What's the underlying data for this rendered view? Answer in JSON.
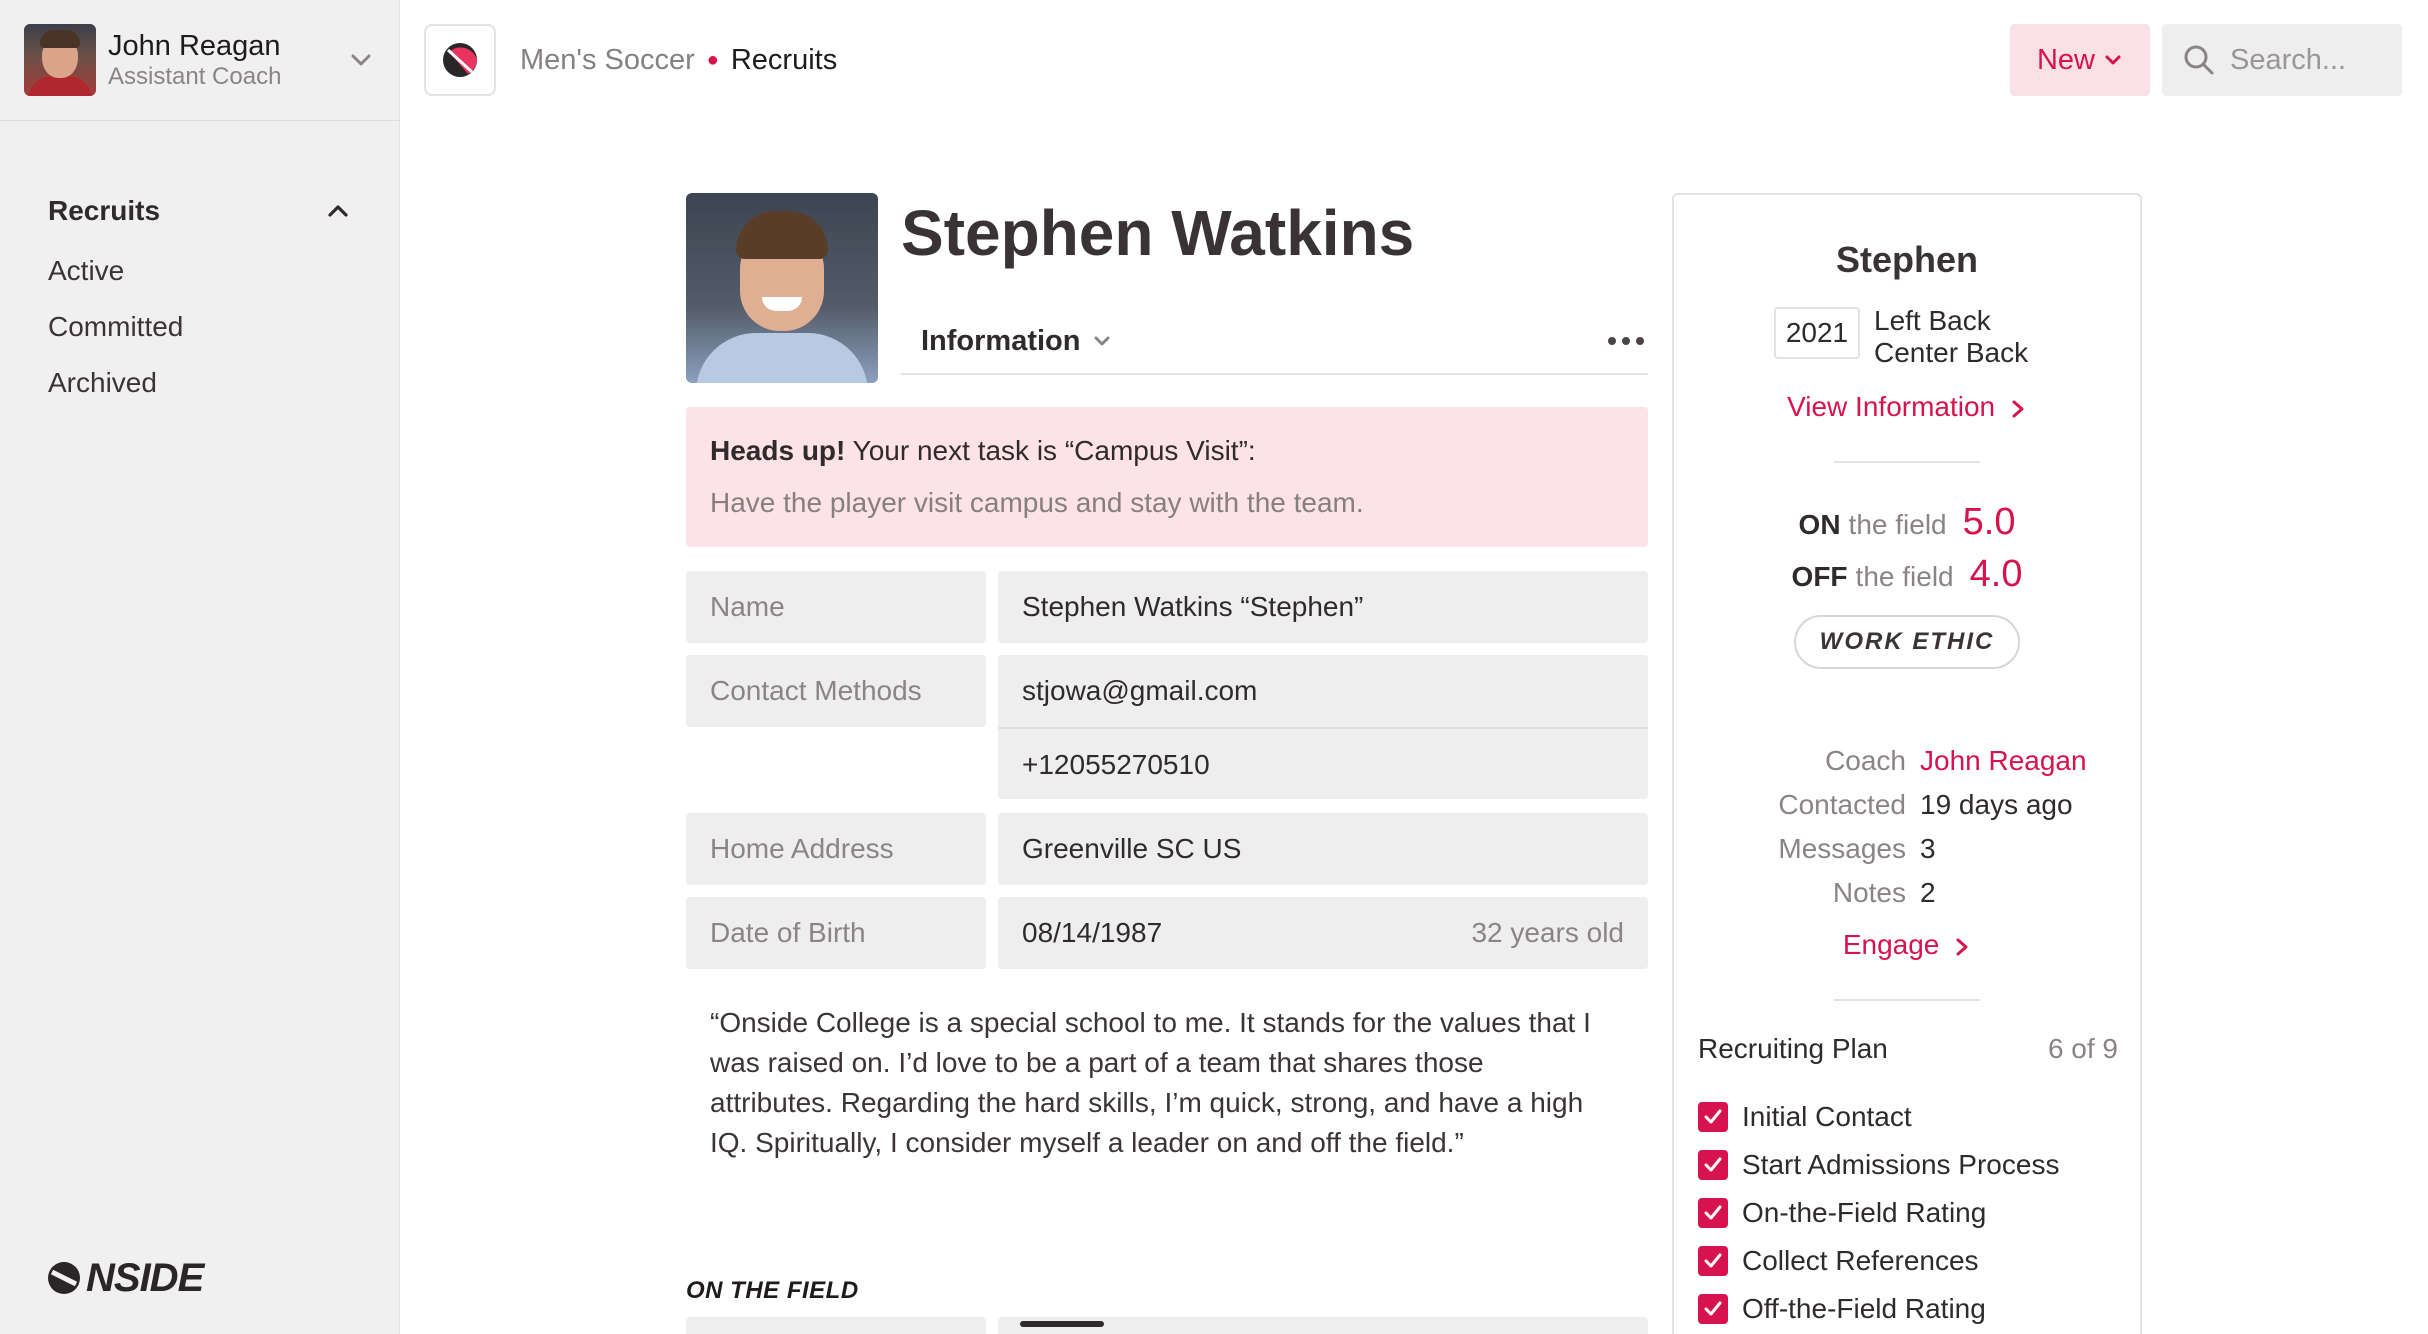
{
  "user": {
    "name": "John Reagan",
    "role": "Assistant Coach"
  },
  "sidebar": {
    "section_title": "Recruits",
    "items": [
      {
        "label": "Active"
      },
      {
        "label": "Committed"
      },
      {
        "label": "Archived"
      }
    ],
    "logo_text": "NSIDE"
  },
  "header": {
    "breadcrumb_parent": "Men's Soccer",
    "breadcrumb_current": "Recruits",
    "new_label": "New",
    "search_placeholder": "Search..."
  },
  "profile": {
    "name": "Stephen Watkins",
    "tab_label": "Information",
    "alert_title": "Heads up!",
    "alert_text": " Your next task is “Campus Visit”:",
    "alert_detail": "Have the player visit campus and stay with the team.",
    "fields": {
      "name_label": "Name",
      "name_value": "Stephen Watkins “Stephen”",
      "contact_label": "Contact Methods",
      "email": "stjowa@gmail.com",
      "phone": "+12055270510",
      "address_label": "Home Address",
      "address_value": "Greenville SC US",
      "dob_label": "Date of Birth",
      "dob_value": "08/14/1987",
      "age": "32 years old"
    },
    "quote": "“Onside College is a special school to me. It stands for the values that I was raised on. I’d love to be a part of a team that shares those attributes. Regarding the hard skills, I’m quick, strong, and have a high IQ. Spiritually, I consider myself a leader on and off the field.”",
    "section_on_field": "ON THE FIELD"
  },
  "card": {
    "first_name": "Stephen",
    "year": "2021",
    "position_1": "Left Back",
    "position_2": "Center Back",
    "view_info": "View Information",
    "on_label": "ON",
    "on_suffix": "the field",
    "on_rating": "5.0",
    "off_label": "OFF",
    "off_suffix": "the field",
    "off_rating": "4.0",
    "tag": "WORK ETHIC",
    "stats": [
      {
        "key": "Coach",
        "value": "John Reagan"
      },
      {
        "key": "Contacted",
        "value": "19 days ago"
      },
      {
        "key": "Messages",
        "value": "3"
      },
      {
        "key": "Notes",
        "value": "2"
      }
    ],
    "engage": "Engage",
    "plan_title": "Recruiting Plan",
    "plan_count": "6 of 9",
    "plan_items": [
      {
        "label": "Initial Contact",
        "checked": true
      },
      {
        "label": "Start Admissions Process",
        "checked": true
      },
      {
        "label": "On-the-Field Rating",
        "checked": true
      },
      {
        "label": "Collect References",
        "checked": true
      },
      {
        "label": "Off-the-Field Rating",
        "checked": true
      }
    ]
  },
  "colors": {
    "accent": "#d6134e",
    "accent_soft": "#fbe0e7",
    "alert_bg": "#fde2e8",
    "sidebar_bg": "#f1f0f0",
    "field_bg": "#efeeee"
  },
  "icons": {
    "user_menu": "chevron-down-icon",
    "nav_collapse": "chevron-up-icon",
    "app": "onside-ball-icon",
    "search": "search-icon",
    "more": "more-horizontal-icon",
    "link": "chevron-right-icon",
    "check": "checkbox-checked-icon"
  }
}
